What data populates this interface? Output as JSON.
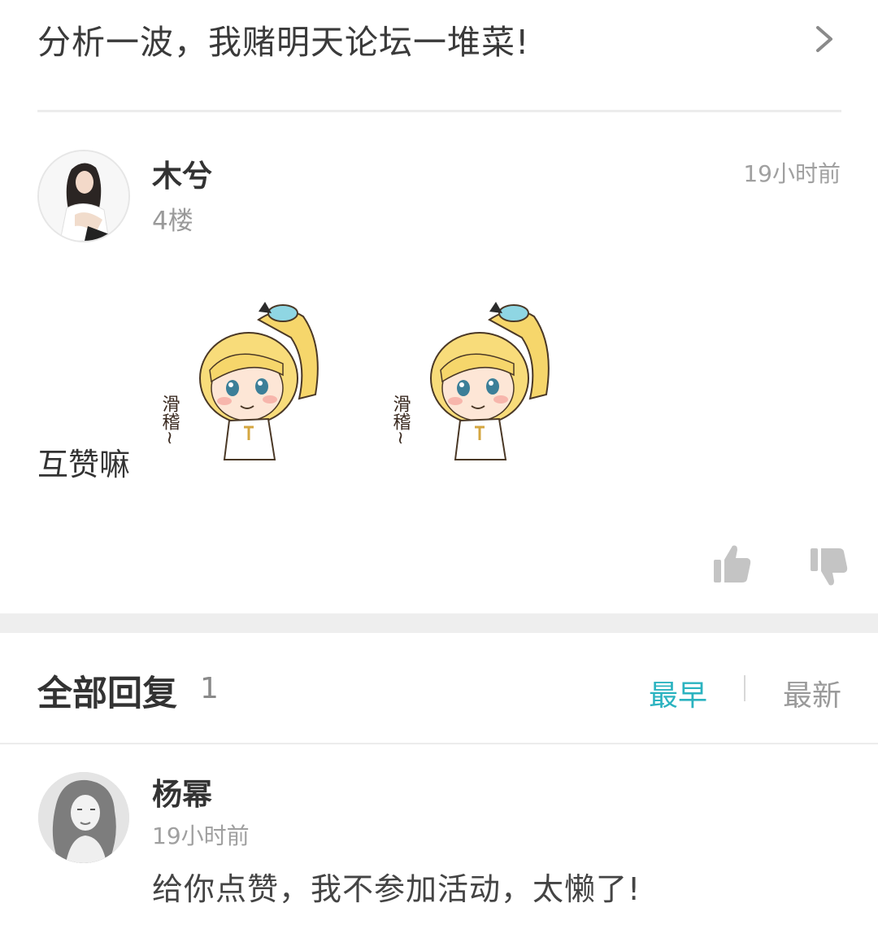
{
  "thread": {
    "title": "分析一波，我赌明天论坛一堆菜!"
  },
  "post": {
    "username": "木兮",
    "floor": "4楼",
    "time": "19小时前",
    "text": "互赞嘛",
    "sticker_text": "滑稽~"
  },
  "replies": {
    "title": "全部回复",
    "count": "1",
    "sort_earliest": "最早",
    "sort_latest": "最新",
    "items": [
      {
        "username": "杨幂",
        "time": "19小时前",
        "text": "给你点赞，我不参加活动，太懒了!"
      }
    ]
  },
  "colors": {
    "accent": "#2bb3c0",
    "muted": "#a0a0a0",
    "text": "#333333",
    "divider": "#ececec"
  },
  "icons": [
    "chevron-right-icon",
    "thumbs-up-icon",
    "thumbs-down-icon"
  ]
}
